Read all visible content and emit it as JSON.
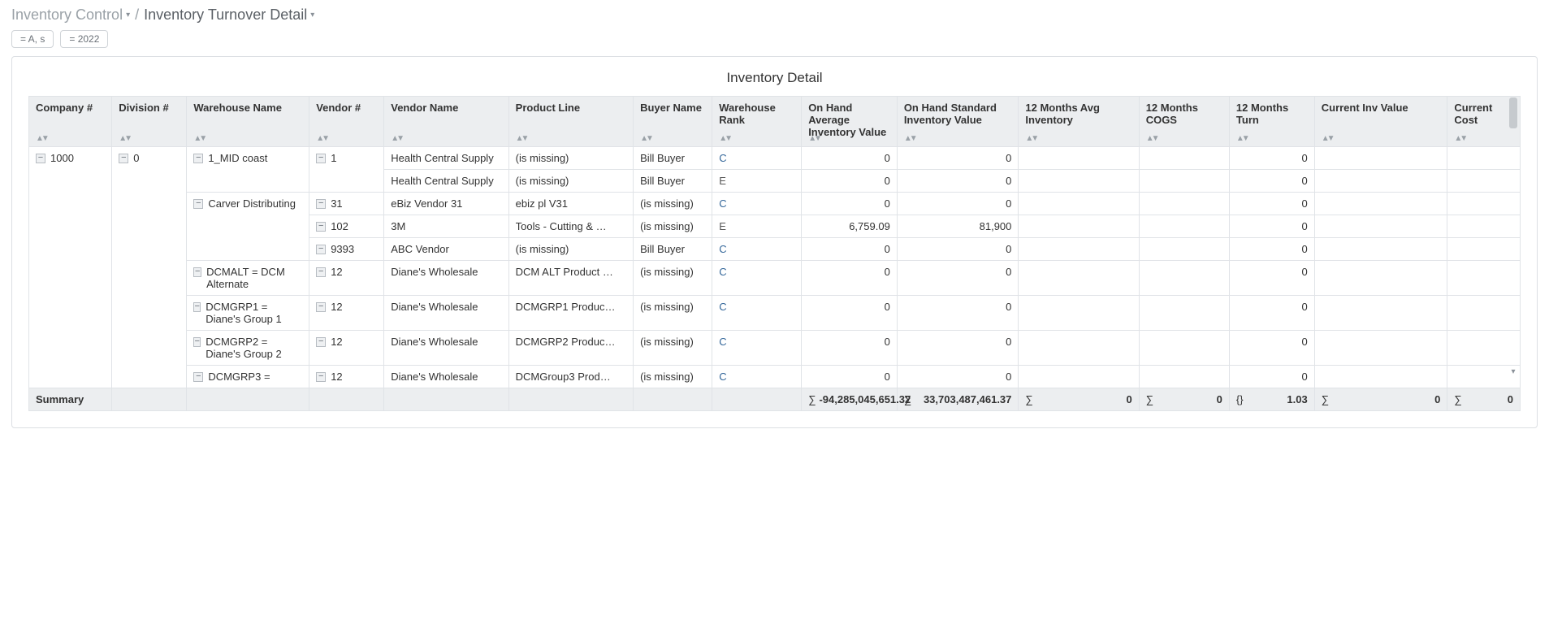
{
  "breadcrumb": {
    "item1": "Inventory Control",
    "sep": "/",
    "item2": "Inventory Turnover Detail"
  },
  "filters": {
    "f1": "= A, s",
    "f2": "= 2022"
  },
  "card_title": "Inventory Detail",
  "columns": {
    "company": "Company #",
    "division": "Division #",
    "warehouse": "Warehouse Name",
    "vendor_num": "Vendor #",
    "vendor_name": "Vendor Name",
    "product_line": "Product Line",
    "buyer": "Buyer Name",
    "rank": "Warehouse Rank",
    "oh_avg": "On Hand Average Inventory Value",
    "oh_std": "On Hand Standard Inventory Value",
    "m12_avg": "12 Months Avg Inventory",
    "m12_cogs": "12 Months COGS",
    "m12_turn": "12 Months Turn",
    "cur_inv": "Current Inv Value",
    "cur_cost": "Current Cost"
  },
  "top": {
    "company": "1000",
    "division": "0"
  },
  "rows": [
    {
      "warehouse": "1_MID coast",
      "vendor_num": "1",
      "vendor_name": "Health Central Supply",
      "product_line": "(is missing)",
      "buyer": "Bill Buyer",
      "rank": "C",
      "oh_avg": "0",
      "oh_std": "0",
      "m12_turn": "0",
      "show_wh": true,
      "show_vn": true
    },
    {
      "vendor_name": "Health Central Supply",
      "product_line": "(is missing)",
      "buyer": "Bill Buyer",
      "rank": "E",
      "oh_avg": "0",
      "oh_std": "0",
      "m12_turn": "0",
      "show_wh": false,
      "show_vn": false
    },
    {
      "warehouse": "Carver Distributing",
      "vendor_num": "31",
      "vendor_name": "eBiz Vendor 31",
      "product_line": "ebiz pl V31",
      "buyer": "(is missing)",
      "rank": "C",
      "oh_avg": "0",
      "oh_std": "0",
      "m12_turn": "0",
      "show_wh": true,
      "show_vn": true
    },
    {
      "vendor_num": "102",
      "vendor_name": "3M",
      "product_line": "Tools - Cutting & …",
      "buyer": "(is missing)",
      "rank": "E",
      "oh_avg": "6,759.09",
      "oh_std": "81,900",
      "m12_turn": "0",
      "show_wh": false,
      "show_vn": true
    },
    {
      "vendor_num": "9393",
      "vendor_name": "ABC Vendor",
      "product_line": "(is missing)",
      "buyer": "Bill Buyer",
      "rank": "C",
      "oh_avg": "0",
      "oh_std": "0",
      "m12_turn": "0",
      "show_wh": false,
      "show_vn": true
    },
    {
      "warehouse": "DCMALT = DCM Alternate",
      "vendor_num": "12",
      "vendor_name": "Diane's Wholesale",
      "product_line": "DCM ALT Product …",
      "buyer": "(is missing)",
      "rank": "C",
      "oh_avg": "0",
      "oh_std": "0",
      "m12_turn": "0",
      "show_wh": true,
      "show_vn": true
    },
    {
      "warehouse": "DCMGRP1 = Diane's Group 1",
      "vendor_num": "12",
      "vendor_name": "Diane's Wholesale",
      "product_line": "DCMGRP1 Produc…",
      "buyer": "(is missing)",
      "rank": "C",
      "oh_avg": "0",
      "oh_std": "0",
      "m12_turn": "0",
      "show_wh": true,
      "show_vn": true
    },
    {
      "warehouse": "DCMGRP2 = Diane's Group 2",
      "vendor_num": "12",
      "vendor_name": "Diane's Wholesale",
      "product_line": "DCMGRP2 Produc…",
      "buyer": "(is missing)",
      "rank": "C",
      "oh_avg": "0",
      "oh_std": "0",
      "m12_turn": "0",
      "show_wh": true,
      "show_vn": true
    },
    {
      "warehouse": "DCMGRP3 =",
      "vendor_num": "12",
      "vendor_name": "Diane's Wholesale",
      "product_line": "DCMGroup3 Prod…",
      "buyer": "(is missing)",
      "rank": "C",
      "oh_avg": "0",
      "oh_std": "0",
      "m12_turn": "0",
      "show_wh": true,
      "show_vn": true
    }
  ],
  "summary": {
    "label": "Summary",
    "oh_avg": "-94,285,045,651.32",
    "oh_std": "33,703,487,461.37",
    "m12_avg": "0",
    "m12_cogs": "0",
    "m12_turn": "1.03",
    "cur_inv": "0",
    "cur_cost": "0",
    "sigma": "∑",
    "braces": "{}"
  }
}
